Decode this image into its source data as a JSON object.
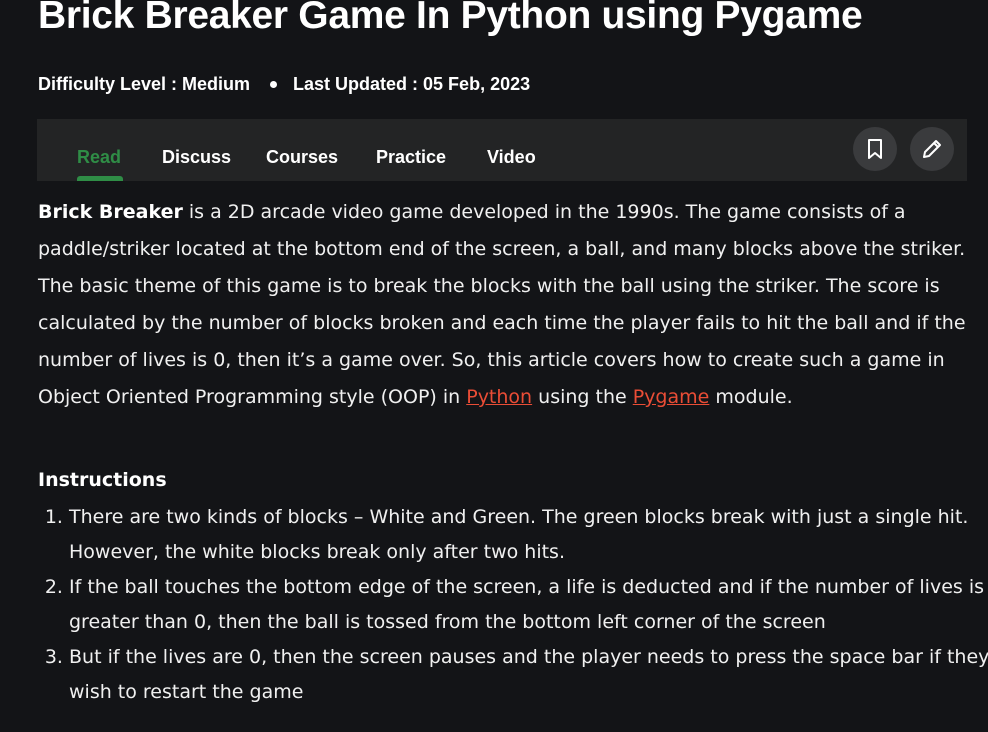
{
  "article": {
    "title": "Brick Breaker Game In Python using Pygame",
    "difficulty": "Difficulty Level : Medium",
    "last_updated": "Last Updated : 05 Feb, 2023"
  },
  "tabs": [
    {
      "label": "Read",
      "active": true
    },
    {
      "label": "Discuss",
      "active": false
    },
    {
      "label": "Courses",
      "active": false
    },
    {
      "label": "Practice",
      "active": false
    },
    {
      "label": "Video",
      "active": false
    }
  ],
  "toolbar": {
    "bookmark_icon": "bookmark-icon",
    "edit_icon": "pencil-icon"
  },
  "intro": {
    "bold_term": "Brick Breaker",
    "text_before_links": " is a 2D arcade video game developed in the 1990s. The game consists of a paddle/striker located at the bottom end of the screen, a ball, and many blocks above the striker. The basic theme of this game is to break the blocks with the ball using the striker. The score is calculated by the number of blocks broken and each time the player fails to hit the ball and if the number of lives is 0, then it’s a game over. So, this article covers how to create such a game in Object Oriented Programming style (OOP) in ",
    "link_python": "Python",
    "text_between_links": " using the ",
    "link_pygame": "Pygame",
    "text_end": " module."
  },
  "instructions": {
    "heading": "Instructions",
    "items": [
      "There are two kinds of blocks – White and Green. The green blocks break with just a single hit. However, the white blocks break only after two hits.",
      "If the ball touches the bottom edge of the screen, a life is deducted and if the number of lives is greater than 0, then the ball is tossed from the bottom left corner of the screen",
      "But if the lives are 0, then the screen pauses and the player needs to press the space bar if they wish to restart the game"
    ]
  },
  "colors": {
    "background": "#131417",
    "tab_bar": "#232425",
    "accent_green": "#2f8d46",
    "link_red": "#ea4d36"
  }
}
